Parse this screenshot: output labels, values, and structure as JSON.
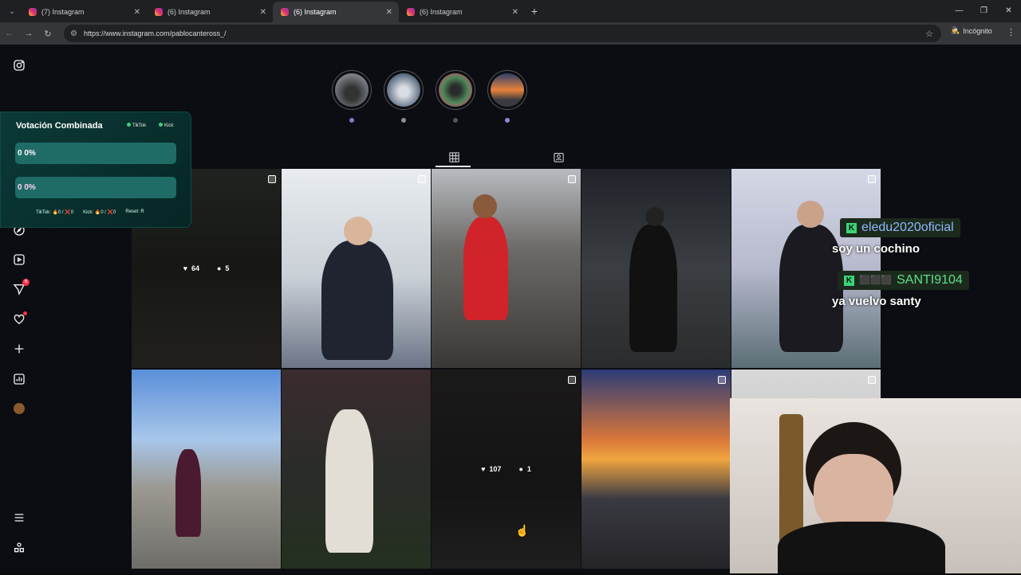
{
  "browser": {
    "tabs": [
      {
        "label": "(7) Instagram",
        "active": false
      },
      {
        "label": "(6) Instagram",
        "active": false
      },
      {
        "label": "(6) Instagram",
        "active": true
      },
      {
        "label": "(6) Instagram",
        "active": false
      }
    ],
    "url": "https://www.instagram.com/pablocanteross_/",
    "profile_label": "Incógnito"
  },
  "sidebar": {
    "notification_count": "6"
  },
  "overlay_vote": {
    "title": "Votación Combinada",
    "badge_tiktok": "TikTok",
    "badge_kick": "Kick",
    "bar1": "0  0%",
    "bar2": "0  0%",
    "footer_tiktok": "TikTok: 🔥0 / ❌0",
    "footer_kick": "Kick: 🔥0 / ❌0",
    "footer_reset": "Reset: R"
  },
  "grid_posts": [
    {
      "likes": "64",
      "comments": "5",
      "hover": true
    },
    {
      "hover": false
    },
    {
      "hover": false
    },
    {
      "hover": false
    },
    {
      "hover": false
    },
    {
      "hover": false
    },
    {
      "hover": false
    },
    {
      "likes": "107",
      "comments": "1",
      "hover": true
    },
    {
      "hover": false
    },
    {
      "hover": false
    }
  ],
  "chat": [
    {
      "user": "eledu2020oficial",
      "message": "soy un cochino"
    },
    {
      "user": "SANTI9104",
      "message": "ya vuelvo santy"
    }
  ],
  "colors": {
    "ig_gradient_start": "#f9c23c",
    "ig_gradient_end": "#833ab4",
    "kick_green": "#3cd37a",
    "chat_name_color": "#8fb8ff"
  }
}
